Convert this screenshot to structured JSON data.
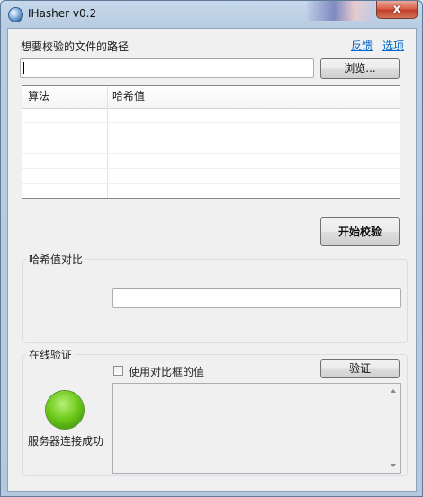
{
  "window": {
    "title": "IHasher v0.2",
    "close_glyph": "x"
  },
  "path_section": {
    "label": "想要校验的文件的路径",
    "feedback_link": "反馈",
    "options_link": "选项",
    "path_value": "",
    "browse_label": "浏览..."
  },
  "hash_table": {
    "columns": [
      "算法",
      "哈希值"
    ],
    "rows": []
  },
  "start_button": "开始校验",
  "compare_group": {
    "title": "哈希值对比",
    "compare_value": ""
  },
  "online_group": {
    "title": "在线验证",
    "checkbox_label": "使用对比框的值",
    "checkbox_checked": false,
    "verify_label": "验证",
    "status_text": "服务器连接成功",
    "status_color": "#5fbf14",
    "result_text": ""
  }
}
